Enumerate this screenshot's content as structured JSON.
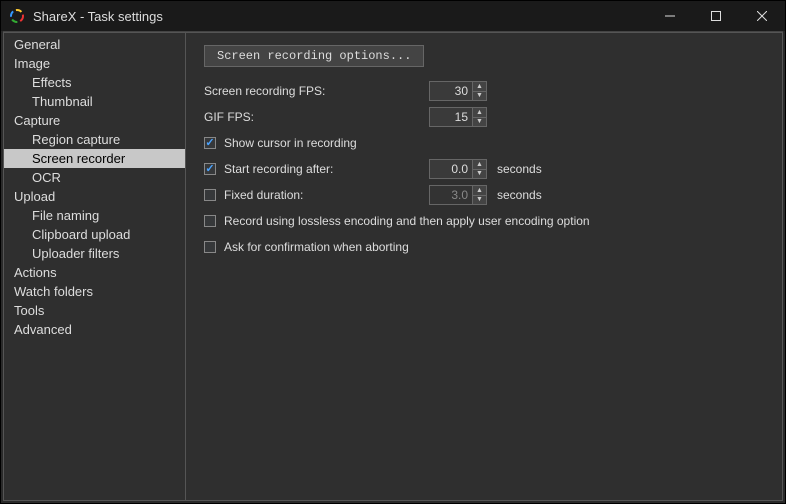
{
  "window": {
    "title": "ShareX - Task settings"
  },
  "sidebar": {
    "items": [
      {
        "label": "General",
        "indent": 0
      },
      {
        "label": "Image",
        "indent": 0
      },
      {
        "label": "Effects",
        "indent": 1
      },
      {
        "label": "Thumbnail",
        "indent": 1
      },
      {
        "label": "Capture",
        "indent": 0
      },
      {
        "label": "Region capture",
        "indent": 1
      },
      {
        "label": "Screen recorder",
        "indent": 1,
        "selected": true
      },
      {
        "label": "OCR",
        "indent": 1
      },
      {
        "label": "Upload",
        "indent": 0
      },
      {
        "label": "File naming",
        "indent": 1
      },
      {
        "label": "Clipboard upload",
        "indent": 1
      },
      {
        "label": "Uploader filters",
        "indent": 1
      },
      {
        "label": "Actions",
        "indent": 0
      },
      {
        "label": "Watch folders",
        "indent": 0
      },
      {
        "label": "Tools",
        "indent": 0
      },
      {
        "label": "Advanced",
        "indent": 0
      }
    ]
  },
  "content": {
    "options_button": "Screen recording options...",
    "fps_label": "Screen recording FPS:",
    "fps_value": "30",
    "gif_fps_label": "GIF FPS:",
    "gif_fps_value": "15",
    "show_cursor_label": "Show cursor in recording",
    "show_cursor_checked": true,
    "start_after_label": "Start recording after:",
    "start_after_checked": true,
    "start_after_value": "0.0",
    "start_after_unit": "seconds",
    "fixed_duration_label": "Fixed duration:",
    "fixed_duration_checked": false,
    "fixed_duration_value": "3.0",
    "fixed_duration_unit": "seconds",
    "lossless_label": "Record using lossless encoding and then apply user encoding option",
    "lossless_checked": false,
    "confirm_abort_label": "Ask for confirmation when aborting",
    "confirm_abort_checked": false
  }
}
